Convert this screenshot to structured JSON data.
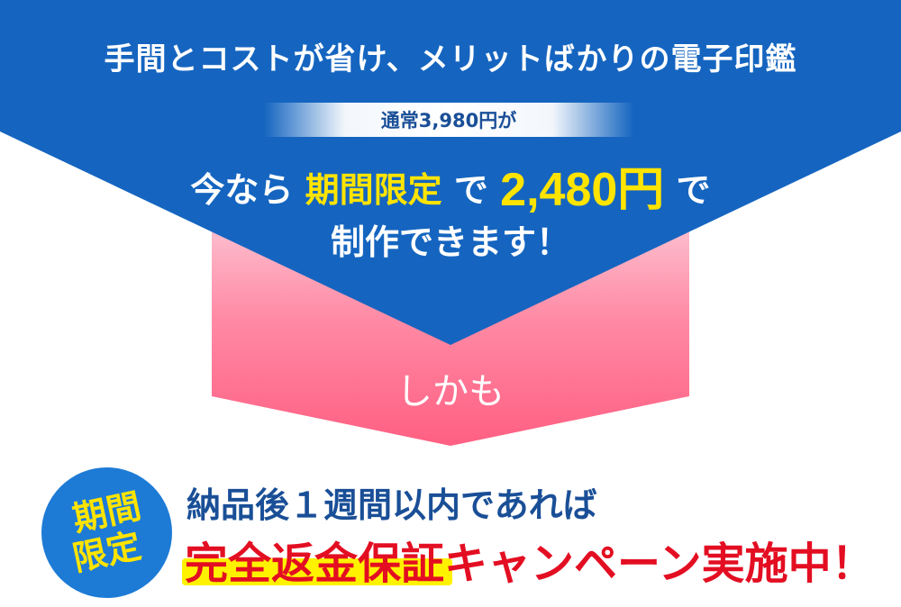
{
  "banner": {
    "headline": "手間とコストが省け、メリットばかりの電子印鑑",
    "regular_price": "通常3,980円が",
    "offer": {
      "prefix": "今なら",
      "highlight": "期間限定",
      "mid": "で",
      "price": "2,480円",
      "suffix": "で",
      "line2": "制作できます！"
    },
    "connector": "しかも",
    "badge": {
      "line1": "期間",
      "line2": "限定"
    },
    "guarantee": {
      "line1": "納品後１週間以内であれば",
      "line2_highlight": "完全返金保証",
      "line2_rest": "キャンペーン実施中！"
    }
  },
  "colors": {
    "blue_band": "#1565c0",
    "pink_arrow": "#ff5f82",
    "highlight_yellow": "#ffe400",
    "badge_blue": "#1d7bd6",
    "headline_navy": "#1a4f97",
    "guarantee_red": "#e30e22"
  }
}
